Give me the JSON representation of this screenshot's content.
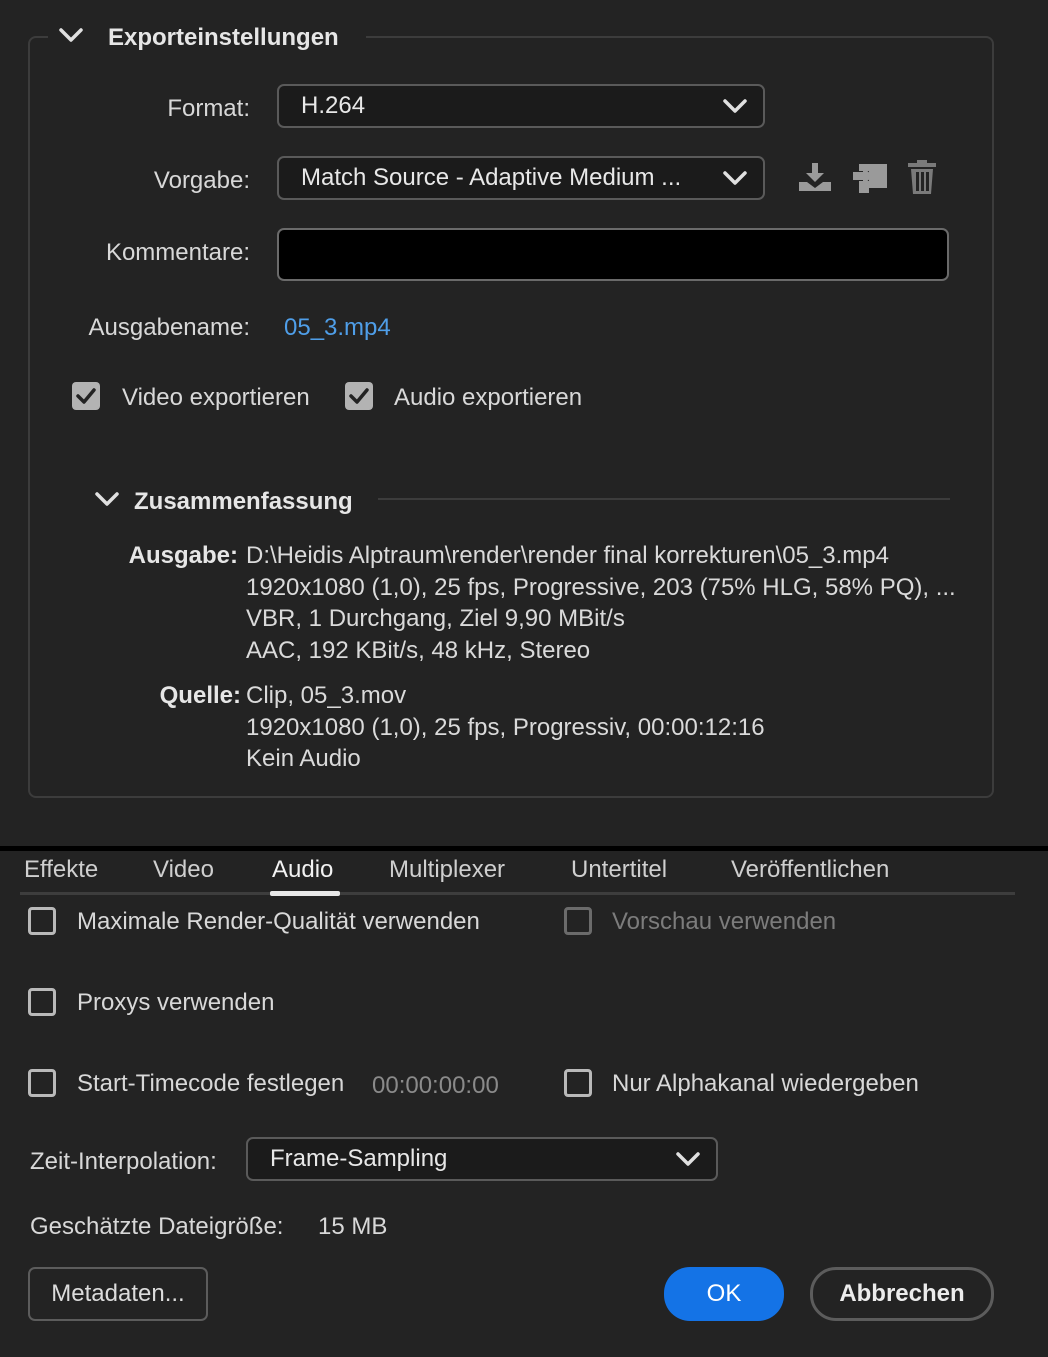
{
  "export_settings": {
    "title": "Exporteinstellungen",
    "format_label": "Format:",
    "format_value": "H.264",
    "preset_label": "Vorgabe:",
    "preset_value": "Match Source - Adaptive Medium ...",
    "comments_label": "Kommentare:",
    "comments_value": "",
    "output_name_label": "Ausgabename:",
    "output_name_value": "05_3.mp4",
    "export_video_label": "Video exportieren",
    "export_video_checked": true,
    "export_audio_label": "Audio exportieren",
    "export_audio_checked": true,
    "preset_icons": [
      "save-preset-icon",
      "import-preset-icon",
      "delete-preset-icon"
    ]
  },
  "summary": {
    "title": "Zusammenfassung",
    "output_key": "Ausgabe:",
    "output_lines": [
      "D:\\Heidis Alptraum\\render\\render final korrekturen\\05_3.mp4",
      "1920x1080 (1,0), 25 fps, Progressive, 203 (75% HLG, 58% PQ), ...",
      "VBR, 1 Durchgang, Ziel 9,90 MBit/s",
      "AAC, 192 KBit/s, 48 kHz, Stereo"
    ],
    "source_key": "Quelle:",
    "source_lines": [
      "Clip, 05_3.mov",
      "1920x1080 (1,0), 25 fps, Progressiv, 00:00:12:16",
      "Kein Audio"
    ]
  },
  "tabs": [
    "Effekte",
    "Video",
    "Audio",
    "Multiplexer",
    "Untertitel",
    "Veröffentlichen"
  ],
  "active_tab": "Audio",
  "options": {
    "max_render_quality": "Maximale Render-Qualität verwenden",
    "use_preview": "Vorschau verwenden",
    "use_proxies": "Proxys verwenden",
    "set_start_timecode": "Start-Timecode festlegen",
    "start_timecode_value": "00:00:00:00",
    "alpha_only": "Nur Alphakanal wiedergeben",
    "time_interpolation_label": "Zeit-Interpolation:",
    "time_interpolation_value": "Frame-Sampling",
    "estimated_size_label": "Geschätzte Dateigröße:",
    "estimated_size_value": "15 MB"
  },
  "buttons": {
    "metadata": "Metadaten...",
    "ok": "OK",
    "cancel": "Abbrechen"
  },
  "colors": {
    "background": "#232323",
    "accent": "#1473e6",
    "link": "#4f9ee8",
    "field": "#000000"
  }
}
